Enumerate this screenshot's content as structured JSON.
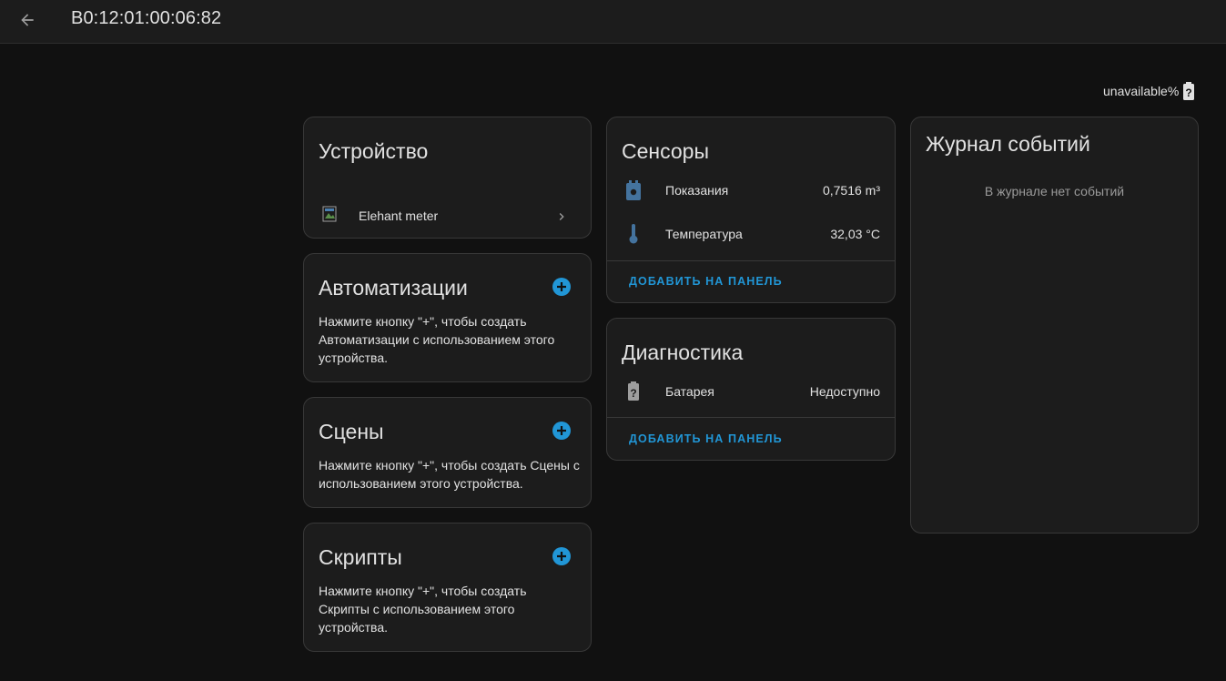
{
  "header": {
    "title": "B0:12:01:00:06:82",
    "back_icon": "arrow-left-icon"
  },
  "battery_status": {
    "text": "unavailable%",
    "icon": "battery-unknown-icon"
  },
  "device_card": {
    "title": "Устройство",
    "device_name": "Elehant meter",
    "chevron_icon": "chevron-right-icon"
  },
  "automations_card": {
    "title": "Автоматизации",
    "description": "Нажмите кнопку \"+\", чтобы создать Автоматизации с использованием этого устройства."
  },
  "scenes_card": {
    "title": "Сцены",
    "description": "Нажмите кнопку \"+\", чтобы создать Сцены с использованием этого устройства."
  },
  "scripts_card": {
    "title": "Скрипты",
    "description": "Нажмите кнопку \"+\", чтобы создать Скрипты с использованием этого устройства."
  },
  "sensors_card": {
    "title": "Сенсоры",
    "rows": [
      {
        "label": "Показания",
        "value": "0,7516 m³",
        "icon": "meter-icon"
      },
      {
        "label": "Температура",
        "value": "32,03 °C",
        "icon": "thermometer-icon"
      }
    ],
    "add_label": "ДОБАВИТЬ НА ПАНЕЛЬ"
  },
  "diagnostics_card": {
    "title": "Диагностика",
    "rows": [
      {
        "label": "Батарея",
        "value": "Недоступно",
        "icon": "battery-unknown-icon"
      }
    ],
    "add_label": "ДОБАВИТЬ НА ПАНЕЛЬ"
  },
  "logbook_card": {
    "title": "Журнал событий",
    "empty_text": "В журнале нет событий"
  },
  "colors": {
    "background": "#111111",
    "card": "#1c1c1c",
    "accent": "#2196d6",
    "sensor_icon": "#44739e"
  }
}
